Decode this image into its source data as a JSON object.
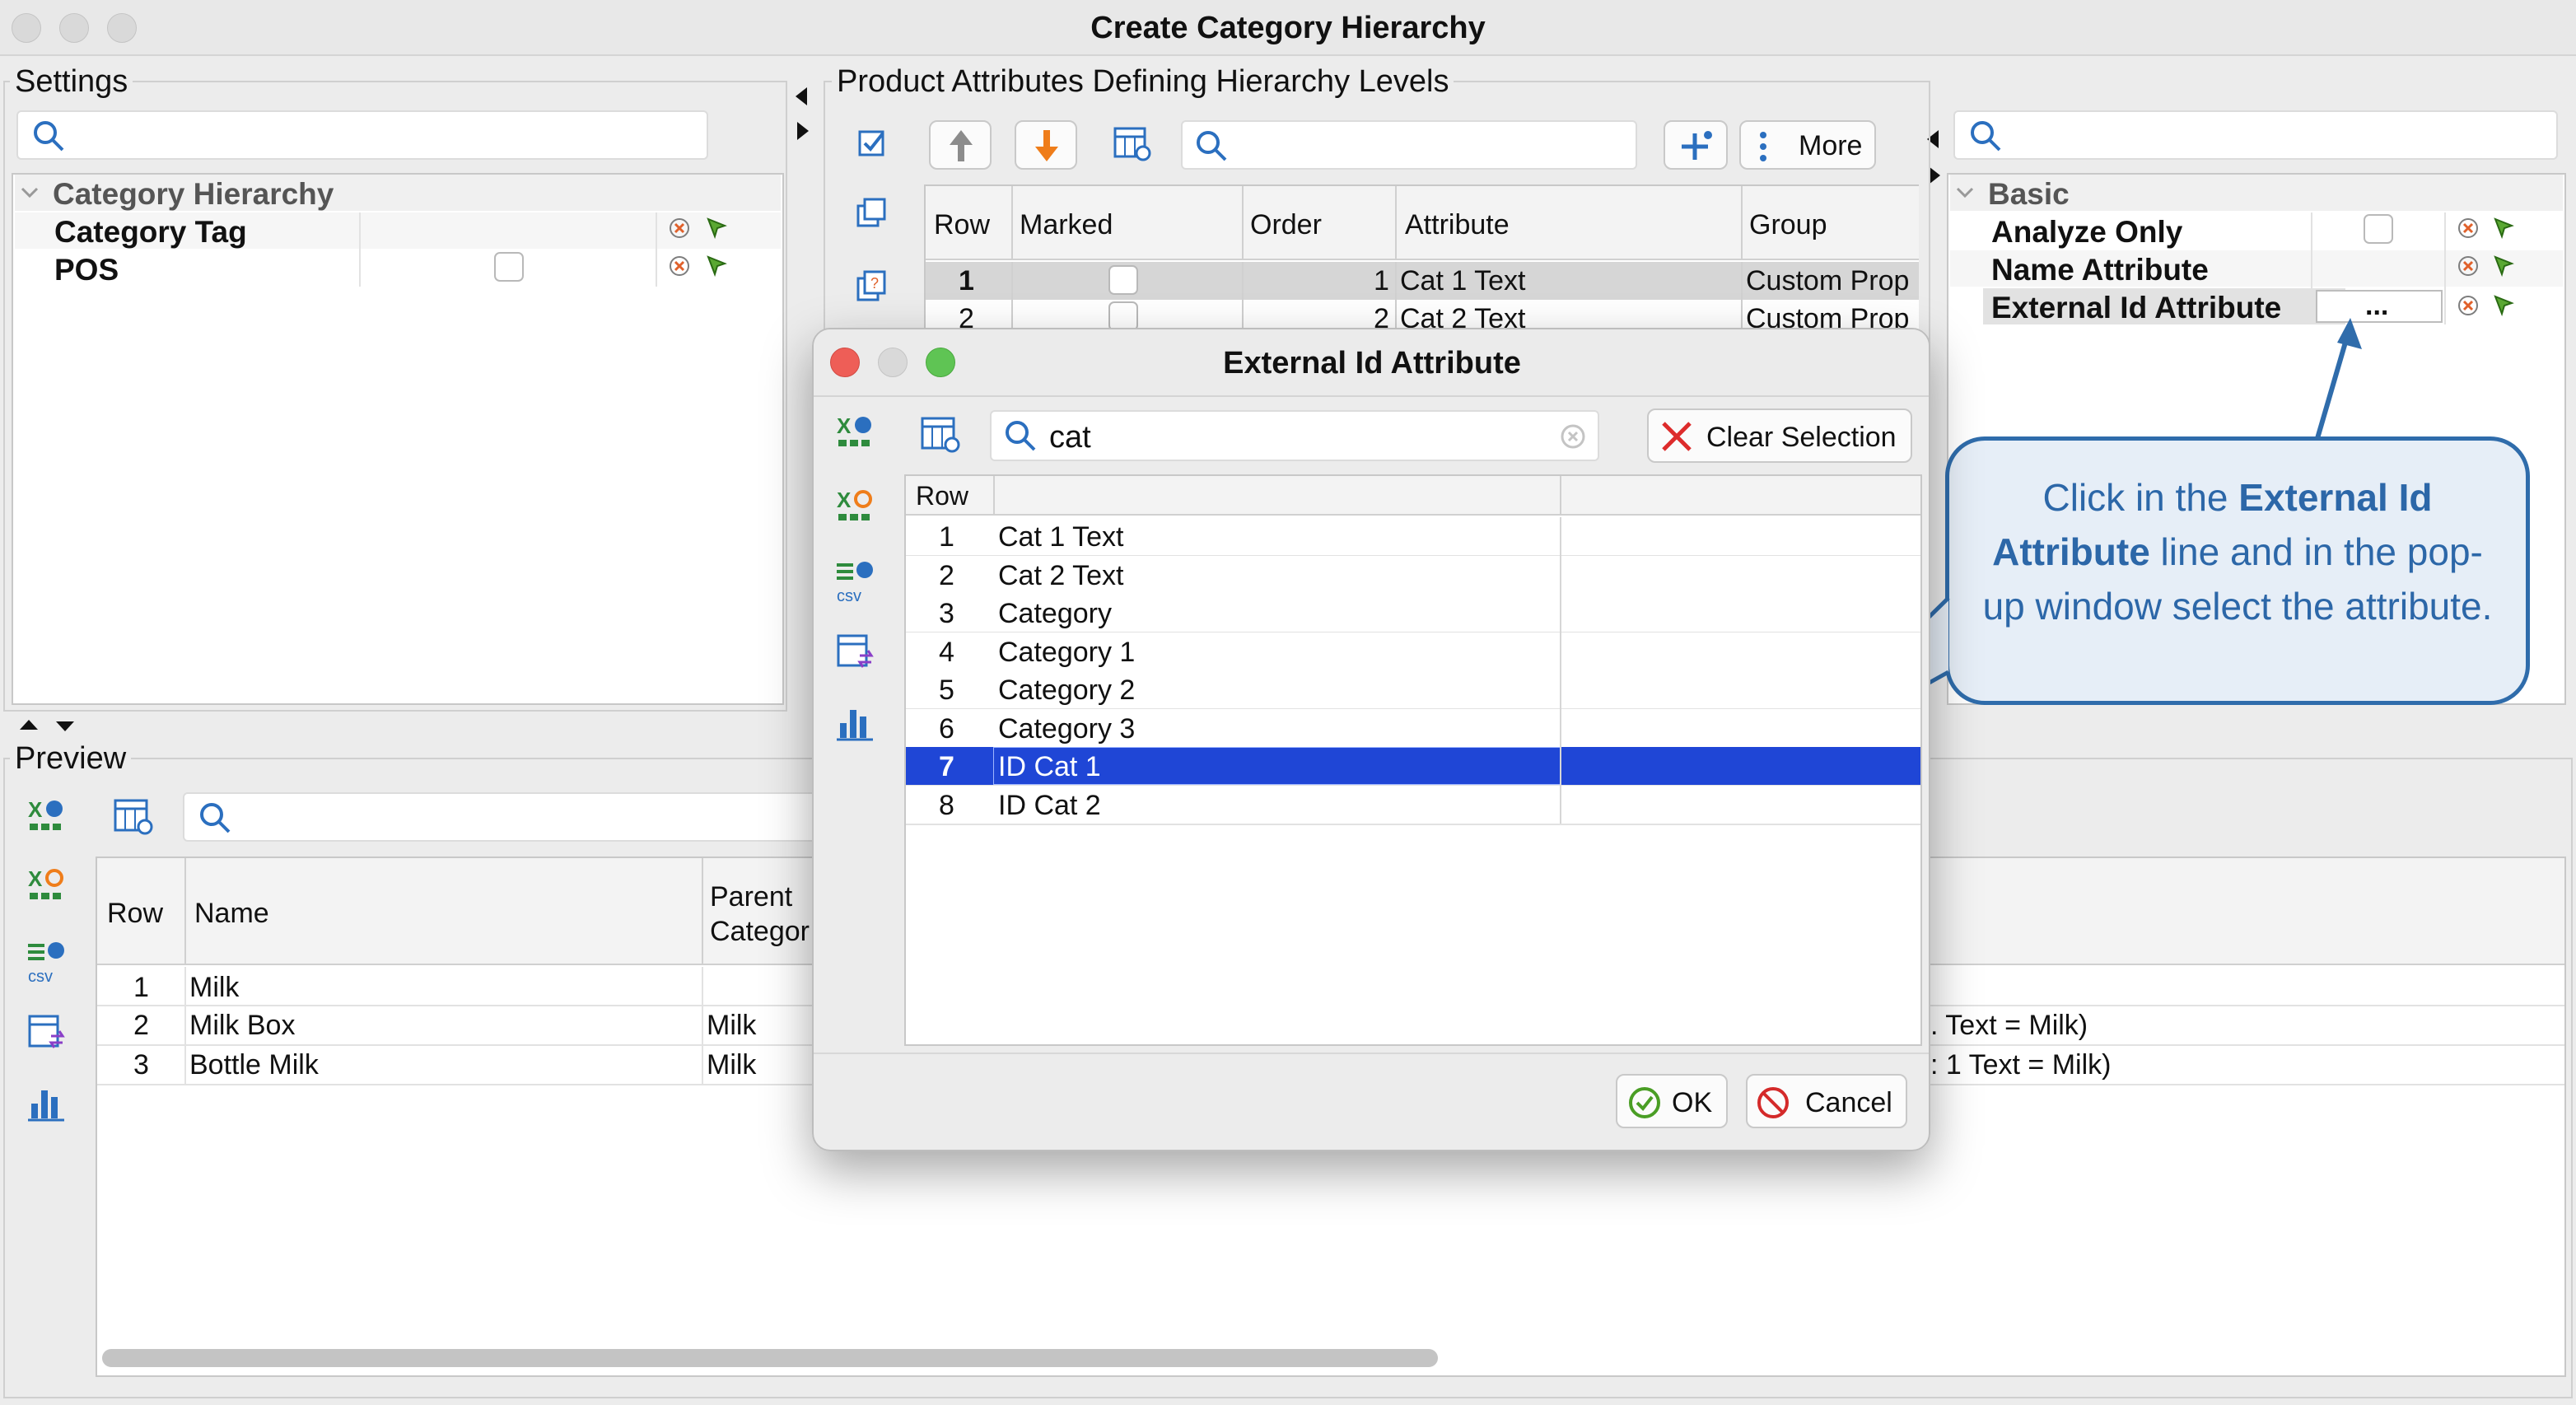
{
  "window": {
    "title": "Create Category Hierarchy"
  },
  "settings": {
    "legend": "Settings",
    "tree": {
      "group": "Category Hierarchy",
      "items": [
        {
          "label": "Category Tag"
        },
        {
          "label": "POS"
        }
      ]
    }
  },
  "attributes_panel": {
    "legend": "Product Attributes Defining Hierarchy Levels",
    "more_label": "More",
    "columns": [
      "Row",
      "Marked",
      "Order",
      "Attribute",
      "Group"
    ],
    "rows": [
      {
        "row": "1",
        "order": "1",
        "attribute": "Cat 1 Text",
        "group": "Custom Prop"
      },
      {
        "row": "2",
        "order": "2",
        "attribute": "Cat 2 Text",
        "group": "Custom Prop"
      }
    ]
  },
  "properties": {
    "group": "Basic",
    "items": [
      {
        "label": "Analyze Only"
      },
      {
        "label": "Name Attribute"
      },
      {
        "label": "External Id Attribute",
        "value": "..."
      }
    ]
  },
  "preview": {
    "legend": "Preview",
    "columns": [
      "Row",
      "Name",
      "Parent\nCategor"
    ],
    "rows": [
      {
        "row": "1",
        "name": "Milk",
        "parent": "",
        "extra": ""
      },
      {
        "row": "2",
        "name": "Milk Box",
        "parent": "Milk",
        "extra": ". Text = Milk)"
      },
      {
        "row": "3",
        "name": "Bottle Milk",
        "parent": "Milk",
        "extra": ": 1 Text = Milk)"
      }
    ]
  },
  "dialog": {
    "title": "External Id Attribute",
    "search_value": "cat",
    "clear_selection_label": "Clear Selection",
    "columns": [
      "Row",
      "",
      ""
    ],
    "rows": [
      {
        "row": "1",
        "name": "Cat 1 Text"
      },
      {
        "row": "2",
        "name": "Cat 2 Text"
      },
      {
        "row": "3",
        "name": "Category"
      },
      {
        "row": "4",
        "name": "Category 1"
      },
      {
        "row": "5",
        "name": "Category 2"
      },
      {
        "row": "6",
        "name": "Category 3"
      },
      {
        "row": "7",
        "name": "ID Cat 1"
      },
      {
        "row": "8",
        "name": "ID Cat 2"
      }
    ],
    "selected_row": "7",
    "ok_label": "OK",
    "cancel_label": "Cancel"
  },
  "callout": {
    "parts": [
      "Click in the ",
      "External Id Attribute",
      " line and in the pop-up window select the attribute."
    ]
  },
  "colors": {
    "selection": "#1f46d6",
    "callout_fill": "#e6eef7",
    "callout_border": "#2f6cab",
    "callout_text": "#2c67a8",
    "close": "#ee5e57",
    "minimize": "#f3bd4f",
    "zoom": "#5fc454"
  }
}
